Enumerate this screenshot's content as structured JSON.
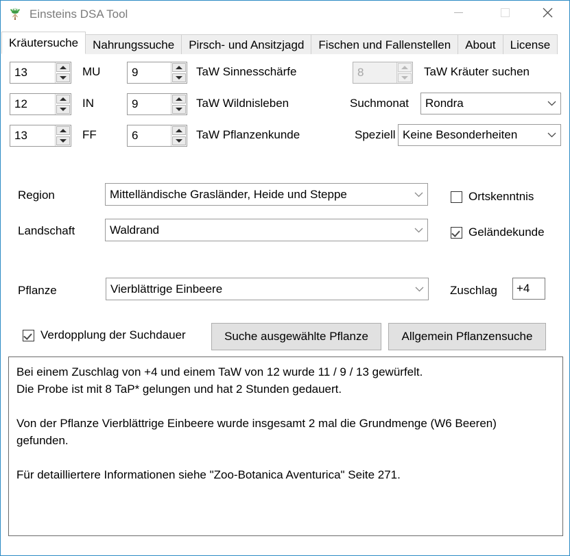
{
  "window": {
    "title": "Einsteins DSA Tool",
    "icon": "plant-icon",
    "accent_border_color": "#2b8ac4",
    "controls": {
      "minimize": "minimize-icon",
      "maximize": "maximize-icon",
      "close": "close-icon"
    }
  },
  "tabs": [
    {
      "label": "Kräutersuche",
      "active": true
    },
    {
      "label": "Nahrungssuche",
      "active": false
    },
    {
      "label": "Pirsch- und Ansitzjagd",
      "active": false
    },
    {
      "label": "Fischen und Fallenstellen",
      "active": false
    },
    {
      "label": "About",
      "active": false
    },
    {
      "label": "License",
      "active": false
    }
  ],
  "attributes": [
    {
      "value": "13",
      "label": "MU"
    },
    {
      "value": "12",
      "label": "IN"
    },
    {
      "value": "13",
      "label": "FF"
    }
  ],
  "skills": [
    {
      "value": "9",
      "label": "TaW Sinnesschärfe"
    },
    {
      "value": "9",
      "label": "TaW Wildnisleben"
    },
    {
      "value": "6",
      "label": "TaW Pflanzenkunde"
    }
  ],
  "kraeuter": {
    "taw_value": "8",
    "taw_label": "TaW Kräuter suchen",
    "taw_disabled": true,
    "suchmonat_label": "Suchmonat",
    "suchmonat_value": "Rondra",
    "speziell_label": "Speziell",
    "speziell_value": "Keine Besonderheiten"
  },
  "location": {
    "region_label": "Region",
    "region_value": "Mittelländische Grasländer, Heide und Steppe",
    "landschaft_label": "Landschaft",
    "landschaft_value": "Waldrand",
    "ortskenntnis_label": "Ortskenntnis",
    "ortskenntnis_checked": false,
    "gelaendekunde_label": "Geländekunde",
    "gelaendekunde_checked": true
  },
  "plant": {
    "pflanze_label": "Pflanze",
    "pflanze_value": "Vierblättrige Einbeere",
    "zuschlag_label": "Zuschlag",
    "zuschlag_value": "+4"
  },
  "actions": {
    "verdopplung_label": "Verdopplung der Suchdauer",
    "verdopplung_checked": true,
    "search_selected_label": "Suche ausgewählte Pflanze",
    "search_general_label": "Allgemein Pflanzensuche"
  },
  "output": {
    "text": "Bei einem Zuschlag von +4 und einem TaW von 12 wurde 11 / 9 / 13 gewürfelt.\nDie Probe ist mit 8 TaP* gelungen und hat 2 Stunden gedauert.\n\nVon der Pflanze Vierblättrige Einbeere wurde insgesamt 2 mal die Grundmenge (W6 Beeren)\ngefunden.\n\nFür detailliertere Informationen siehe \"Zoo-Botanica Aventurica\" Seite 271."
  }
}
